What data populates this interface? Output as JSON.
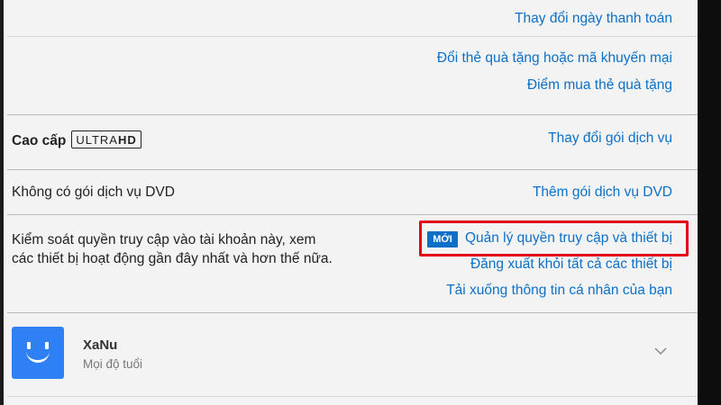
{
  "billing": {
    "change_payment_date": "Thay đổi ngày thanh toán",
    "redeem_gift": "Đổi thẻ quà tặng hoặc mã khuyến mại",
    "where_to_buy_gift": "Điểm mua thẻ quà tặng"
  },
  "plan": {
    "label": "Cao cấp",
    "badge_text": "ULTRA",
    "badge_bold": "HD",
    "change_plan": "Thay đổi gói dịch vụ"
  },
  "dvd": {
    "label": "Không có gói dịch vụ DVD",
    "add_dvd": "Thêm gói dịch vụ DVD"
  },
  "security": {
    "description_line1": "Kiểm soát quyền truy cập vào tài khoản này, xem",
    "description_line2": "các thiết bị hoạt động gần đây nhất và hơn thế nữa.",
    "new_badge": "MỚI",
    "manage_access": "Quản lý quyền truy cập và thiết bị",
    "sign_out_all": "Đăng xuất khỏi tất cả các thiết bị",
    "download_info": "Tải xuống thông tin cá nhân của bạn"
  },
  "profile": {
    "name": "XaNu",
    "rating": "Mọi độ tuổi",
    "avatar_icon": "smiley-face-icon",
    "expand_icon": "chevron-down-icon"
  },
  "colors": {
    "link": "#0c70c7",
    "highlight": "#e3001b",
    "avatar": "#2f7ff5"
  }
}
